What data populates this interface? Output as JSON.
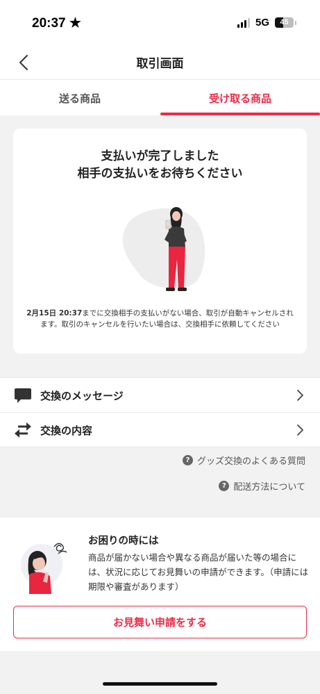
{
  "status": {
    "time": "20:37 ★",
    "network": "5G",
    "battery": "45",
    "battery_level": 0.45
  },
  "nav": {
    "title": "取引画面"
  },
  "tabs": [
    {
      "label": "送る商品",
      "active": false
    },
    {
      "label": "受け取る商品",
      "active": true
    }
  ],
  "card": {
    "title_line1": "支払いが完了しました",
    "title_line2": "相手の支払いをお待ちください",
    "deadline": "2月15日 20:37",
    "notice": "までに交換相手の支払いがない場合、取引が自動キャンセルされます。取引のキャンセルを行いたい場合は、交換相手に依頼してください"
  },
  "menu": [
    {
      "label": "交換のメッセージ",
      "icon": "chat-bubble-icon"
    },
    {
      "label": "交換の内容",
      "icon": "swap-arrows-icon"
    }
  ],
  "help_links": [
    {
      "label": "グッズ交換のよくある質問",
      "icon": "question-circle-icon"
    },
    {
      "label": "配送方法について",
      "icon": "question-circle-icon"
    }
  ],
  "trouble": {
    "title": "お困りの時には",
    "body": "商品が届かない場合や異なる商品が届いた等の場合には、状況に応じてお見舞いの申請ができます。（申請には期限や審査があります）",
    "button": "お見舞い申請をする"
  },
  "colors": {
    "accent": "#ee2b47",
    "background": "#f2f2f2"
  }
}
